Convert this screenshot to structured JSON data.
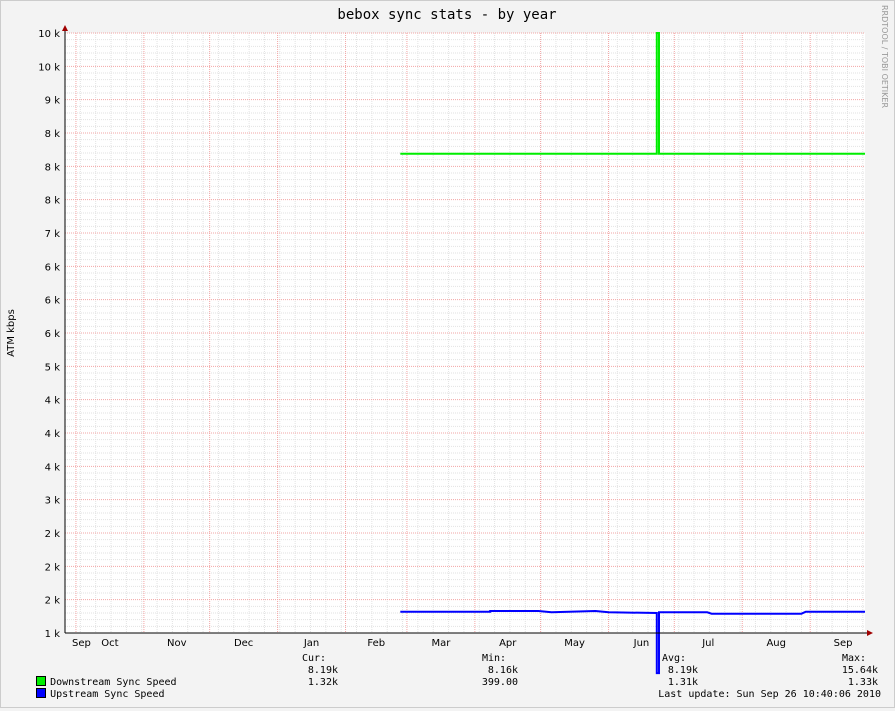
{
  "chart_data": {
    "type": "line",
    "title": "bebox sync stats - by year",
    "ylabel": "ATM kbps",
    "watermark": "RRDTOOL / TOBI OETIKER",
    "ylim": [
      1000,
      10000
    ],
    "y_tick_labels": [
      "10 k",
      "10 k",
      "9 k",
      "8 k",
      "8 k",
      "8 k",
      "7 k",
      "6 k",
      "6 k",
      "6 k",
      "5 k",
      "4 k",
      "4 k",
      "4 k",
      "3 k",
      "2 k",
      "2 k",
      "2 k",
      "1 k"
    ],
    "x_tick_labels": [
      "Sep",
      "Oct",
      "Nov",
      "Dec",
      "Jan",
      "Feb",
      "Mar",
      "Apr",
      "May",
      "Jun",
      "Jul",
      "Aug",
      "Sep"
    ],
    "x_range": [
      "2009-09-26",
      "2010-09-26"
    ],
    "grid": true,
    "series": [
      {
        "name": "Downstream Sync Speed",
        "color": "#00ee00",
        "x": [
          "2010-02-26",
          "2010-06-23",
          "2010-06-23",
          "2010-06-24",
          "2010-06-24",
          "2010-09-26"
        ],
        "values": [
          8190,
          8190,
          15640,
          15640,
          8190,
          8190
        ]
      },
      {
        "name": "Upstream Sync Speed",
        "color": "#0000ff",
        "x": [
          "2010-02-26",
          "2010-04-08",
          "2010-04-08",
          "2010-04-30",
          "2010-05-06",
          "2010-05-26",
          "2010-06-01",
          "2010-06-23",
          "2010-06-23",
          "2010-06-24",
          "2010-06-24",
          "2010-07-16",
          "2010-07-18",
          "2010-08-28",
          "2010-08-30",
          "2010-09-26"
        ],
        "values": [
          1320,
          1320,
          1330,
          1330,
          1310,
          1330,
          1310,
          1300,
          399,
          399,
          1310,
          1310,
          1290,
          1290,
          1320,
          1320
        ]
      }
    ]
  },
  "legend": {
    "headers": {
      "cur": "Cur:",
      "min": "Min:",
      "avg": "Avg:",
      "max": "Max:"
    },
    "rows": [
      {
        "label": "Downstream Sync Speed",
        "color": "#00ee00",
        "cur": "8.19k",
        "min": "8.16k",
        "avg": "8.19k",
        "max": "15.64k"
      },
      {
        "label": "Upstream Sync Speed",
        "color": "#0000ff",
        "cur": "1.32k",
        "min": "399.00",
        "avg": "1.31k",
        "max": "1.33k"
      }
    ],
    "last_update": "Last update: Sun Sep 26 10:40:06 2010"
  }
}
